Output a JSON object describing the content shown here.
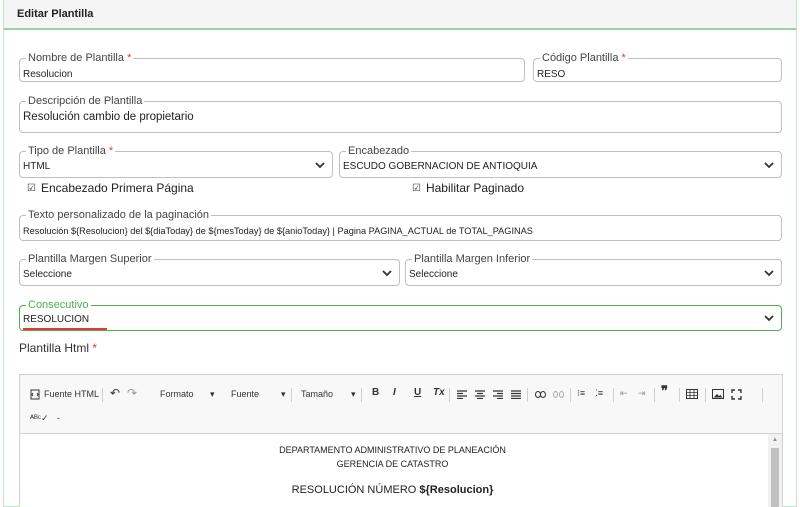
{
  "header": {
    "title": "Editar Plantilla"
  },
  "required_mark": "*",
  "fields": {
    "nombre": {
      "label": "Nombre de Plantilla",
      "value": "Resolucion"
    },
    "codigo": {
      "label": "Código Plantilla",
      "value": "RESO"
    },
    "descripcion": {
      "label": "Descripción de Plantilla",
      "value": "Resolución cambio de propietario"
    },
    "tipo": {
      "label": "Tipo de Plantilla",
      "value": "HTML"
    },
    "encabezado": {
      "label": "Encabezado",
      "value": "ESCUDO GOBERNACION DE ANTIOQUIA"
    },
    "texto_paginacion": {
      "label": "Texto personalizado de la paginación",
      "value": "Resolución ${Resolucion} del ${diaToday} de ${mesToday} de ${anioToday} | Pagina PAGINA_ACTUAL de TOTAL_PAGINAS"
    },
    "margen_superior": {
      "label": "Plantilla Margen Superior",
      "value": "Seleccione"
    },
    "margen_inferior": {
      "label": "Plantilla Margen Inferior",
      "value": "Seleccione"
    },
    "consecutivo": {
      "label": "Consecutivo",
      "value": "RESOLUCION"
    }
  },
  "checkboxes": {
    "encabezado_primera": {
      "label": "Encabezado Primera Página",
      "checked": true
    },
    "habilitar_paginado": {
      "label": "Habilitar Paginado",
      "checked": true
    }
  },
  "editor": {
    "label": "Plantilla Html",
    "toolbar": {
      "source": "Fuente HTML",
      "format": "Formato",
      "font": "Fuente",
      "size": "Tamaño",
      "bold": "B",
      "italic": "I",
      "underline": "U",
      "clear": "Tx",
      "spell": "-"
    },
    "content": {
      "line1": "DEPARTAMENTO ADMINISTRATIVO DE PLANEACIÓN",
      "line2": "GERENCIA DE CATASTRO",
      "line3_prefix": "RESOLUCIÓN NÚMERO ",
      "line3_var": "${Resolucion}"
    }
  },
  "colors": {
    "accent_green": "#4caf50",
    "required_red": "#e53935"
  }
}
